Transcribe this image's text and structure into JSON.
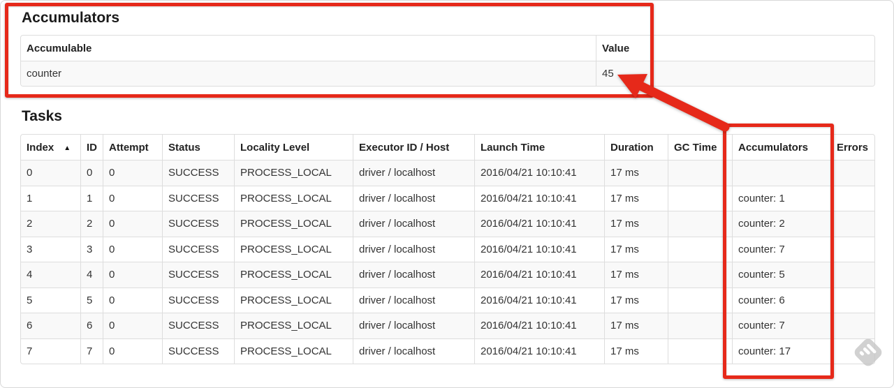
{
  "accumulators_section": {
    "title": "Accumulators",
    "table": {
      "headers": [
        "Accumulable",
        "Value"
      ],
      "rows": [
        [
          "counter",
          "45"
        ]
      ]
    }
  },
  "tasks_section": {
    "title": "Tasks",
    "table": {
      "headers": [
        "Index",
        "ID",
        "Attempt",
        "Status",
        "Locality Level",
        "Executor ID / Host",
        "Launch Time",
        "Duration",
        "GC Time",
        "Accumulators",
        "Errors"
      ],
      "sort_column": "Index",
      "sort_direction_icon": "▲",
      "rows": [
        [
          "0",
          "0",
          "0",
          "SUCCESS",
          "PROCESS_LOCAL",
          "driver / localhost",
          "2016/04/21 10:10:41",
          "17 ms",
          "",
          "",
          ""
        ],
        [
          "1",
          "1",
          "0",
          "SUCCESS",
          "PROCESS_LOCAL",
          "driver / localhost",
          "2016/04/21 10:10:41",
          "17 ms",
          "",
          "counter: 1",
          ""
        ],
        [
          "2",
          "2",
          "0",
          "SUCCESS",
          "PROCESS_LOCAL",
          "driver / localhost",
          "2016/04/21 10:10:41",
          "17 ms",
          "",
          "counter: 2",
          ""
        ],
        [
          "3",
          "3",
          "0",
          "SUCCESS",
          "PROCESS_LOCAL",
          "driver / localhost",
          "2016/04/21 10:10:41",
          "17 ms",
          "",
          "counter: 7",
          ""
        ],
        [
          "4",
          "4",
          "0",
          "SUCCESS",
          "PROCESS_LOCAL",
          "driver / localhost",
          "2016/04/21 10:10:41",
          "17 ms",
          "",
          "counter: 5",
          ""
        ],
        [
          "5",
          "5",
          "0",
          "SUCCESS",
          "PROCESS_LOCAL",
          "driver / localhost",
          "2016/04/21 10:10:41",
          "17 ms",
          "",
          "counter: 6",
          ""
        ],
        [
          "6",
          "6",
          "0",
          "SUCCESS",
          "PROCESS_LOCAL",
          "driver / localhost",
          "2016/04/21 10:10:41",
          "17 ms",
          "",
          "counter: 7",
          ""
        ],
        [
          "7",
          "7",
          "0",
          "SUCCESS",
          "PROCESS_LOCAL",
          "driver / localhost",
          "2016/04/21 10:10:41",
          "17 ms",
          "",
          "counter: 17",
          ""
        ]
      ]
    }
  },
  "annotations": {
    "red_color": "#e6291a",
    "boxes": [
      "accumulators-section",
      "accumulators-column"
    ],
    "arrow": "points-from-accumulators-column-to-value-45"
  },
  "watermark_icon": "feedly-logo"
}
